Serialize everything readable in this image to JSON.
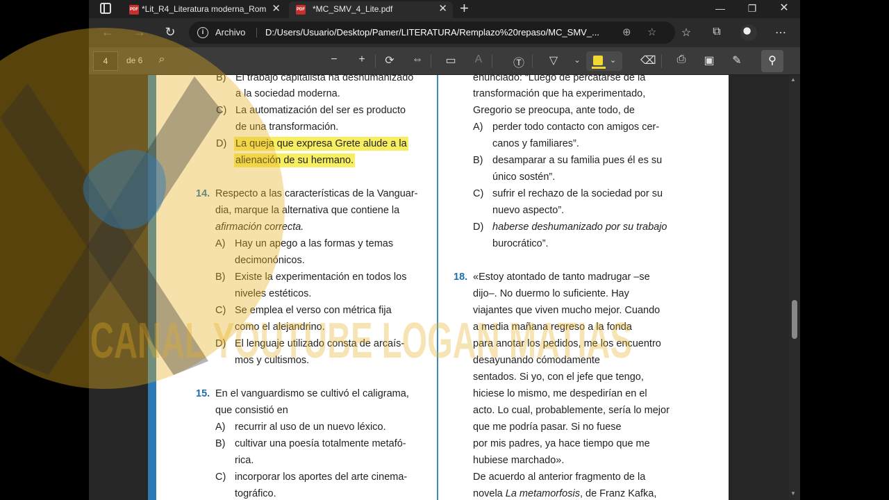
{
  "tabs": [
    {
      "title": "*Lit_R4_Literatura moderna_Rom",
      "active": false
    },
    {
      "title": "*MC_SMV_4_Lite.pdf",
      "active": true
    }
  ],
  "address": {
    "site_label": "Archivo",
    "url": "D:/Users/Usuario/Desktop/Pamer/LITERATURA/Remplazo%20repaso/MC_SMV_..."
  },
  "pdf_toolbar": {
    "page_number": "4",
    "page_of": "de 6"
  },
  "left_column": {
    "q13_options": [
      {
        "letter": "B)",
        "lines": [
          "El trabajo capitalista ha deshumanizado",
          "a la sociedad moderna."
        ]
      },
      {
        "letter": "C)",
        "lines": [
          "La automatización del ser es producto",
          "de una transformación."
        ]
      },
      {
        "letter": "D)",
        "lines": [
          "La queja que expresa Grete alude a la",
          "alienación de su hermano."
        ],
        "highlighted": true
      }
    ],
    "q14": {
      "number": "14.",
      "lines": [
        "Respecto a las características de la Vanguar-",
        "dia, marque la alternativa que contiene la",
        "afirmación correcta."
      ],
      "options": [
        {
          "letter": "A)",
          "lines": [
            "Hay un apego a las formas y temas",
            "decimonónicos."
          ]
        },
        {
          "letter": "B)",
          "lines": [
            "Existe la experimentación en todos los",
            "niveles estéticos."
          ]
        },
        {
          "letter": "C)",
          "lines": [
            "Se emplea el verso con métrica fija",
            "como el alejandrino."
          ]
        },
        {
          "letter": "D)",
          "lines": [
            "El lenguaje utilizado consta de arcaís-",
            "mos y cultismos."
          ]
        }
      ]
    },
    "q15": {
      "number": "15.",
      "lines": [
        "En el vanguardismo se cultivó el caligrama,",
        "que consistió en"
      ],
      "options": [
        {
          "letter": "A)",
          "lines": [
            "recurrir al uso de un nuevo léxico."
          ]
        },
        {
          "letter": "B)",
          "lines": [
            "cultivar una poesía totalmente metafó-",
            "rica."
          ]
        },
        {
          "letter": "C)",
          "lines": [
            "incorporar los aportes del arte cinema-",
            "tográfico."
          ]
        }
      ]
    }
  },
  "right_column": {
    "q17_lines": [
      "enunciado: “Luego de percatarse de la",
      "transformación que ha experimentado,",
      "Gregorio se preocupa, ante todo, de"
    ],
    "q17_options": [
      {
        "letter": "A)",
        "lines": [
          "perder todo contacto con amigos cer-",
          "canos y familiares”."
        ]
      },
      {
        "letter": "B)",
        "lines": [
          "desamparar a su familia pues él es su",
          "único sostén”."
        ]
      },
      {
        "letter": "C)",
        "lines": [
          "sufrir el rechazo de la sociedad por su",
          "nuevo aspecto”."
        ]
      },
      {
        "letter": "D)",
        "lines": [
          "haberse deshumanizado por su trabajo",
          "burocrático”."
        ]
      }
    ],
    "q18": {
      "number": "18.",
      "lines": [
        "«Estoy atontado de tanto madrugar –se",
        "dijo–. No duermo lo suficiente. Hay",
        "viajantes que viven mucho mejor. Cuando",
        "a media mañana regreso a la fonda",
        "para anotar los pedidos, me los encuentro",
        "desayunando cómodamente",
        "sentados. Si yo, con el jefe que tengo,",
        "hiciese lo mismo, me despedirían en el",
        "acto. Lo cual, probablemente, sería lo mejor",
        "que me podría pasar. Si no fuese",
        "por mis padres, ya hace tiempo que me",
        "hubiese marchado».",
        "De acuerdo al anterior fragmento de la",
        "novela La metamorfosis, de Franz Kafka,"
      ]
    }
  },
  "watermark": {
    "text": "CANAL YOUTUBE LOGAN MATIAS"
  },
  "colors": {
    "highlight": "#f7ef5f",
    "question_number": "#1b6fae",
    "page_edge": "#2b7ab5"
  }
}
